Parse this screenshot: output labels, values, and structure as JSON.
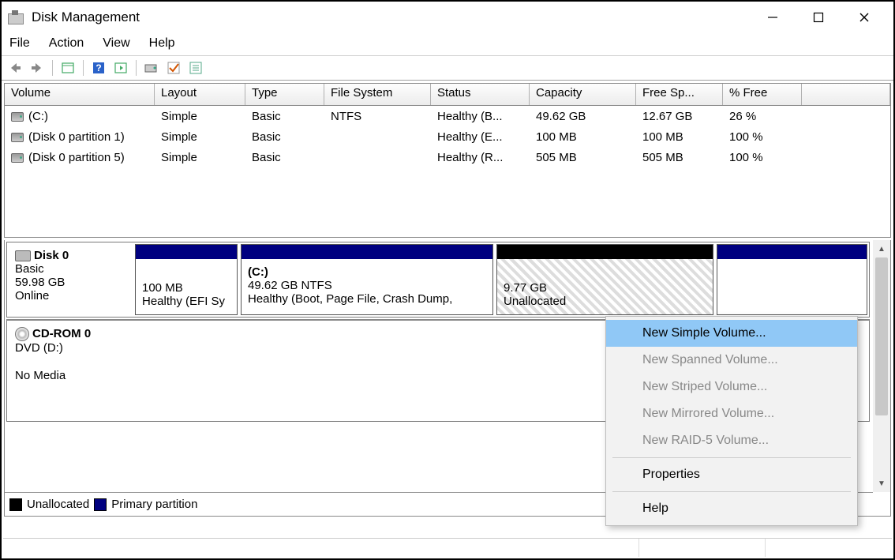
{
  "window": {
    "title": "Disk Management"
  },
  "menu": {
    "file": "File",
    "action": "Action",
    "view": "View",
    "help": "Help"
  },
  "table": {
    "headers": {
      "volume": "Volume",
      "layout": "Layout",
      "type": "Type",
      "fs": "File System",
      "status": "Status",
      "capacity": "Capacity",
      "free": "Free Sp...",
      "pct": "% Free"
    },
    "rows": [
      {
        "volume": "(C:)",
        "layout": "Simple",
        "type": "Basic",
        "fs": "NTFS",
        "status": "Healthy (B...",
        "capacity": "49.62 GB",
        "free": "12.67 GB",
        "pct": "26 %"
      },
      {
        "volume": "(Disk 0 partition 1)",
        "layout": "Simple",
        "type": "Basic",
        "fs": "",
        "status": "Healthy (E...",
        "capacity": "100 MB",
        "free": "100 MB",
        "pct": "100 %"
      },
      {
        "volume": "(Disk 0 partition 5)",
        "layout": "Simple",
        "type": "Basic",
        "fs": "",
        "status": "Healthy (R...",
        "capacity": "505 MB",
        "free": "505 MB",
        "pct": "100 %"
      }
    ]
  },
  "disk0": {
    "name": "Disk 0",
    "type": "Basic",
    "size": "59.98 GB",
    "state": "Online",
    "p1": {
      "size": "100 MB",
      "status": "Healthy (EFI Sy"
    },
    "p2": {
      "label": "(C:)",
      "size": "49.62 GB NTFS",
      "status": "Healthy (Boot, Page File, Crash Dump,"
    },
    "p3": {
      "size": "9.77 GB",
      "status": "Unallocated"
    }
  },
  "cdrom": {
    "name": "CD-ROM 0",
    "label": "DVD (D:)",
    "state": "No Media"
  },
  "legend": {
    "unalloc": "Unallocated",
    "primary": "Primary partition"
  },
  "context": {
    "new_simple": "New Simple Volume...",
    "new_spanned": "New Spanned Volume...",
    "new_striped": "New Striped Volume...",
    "new_mirrored": "New Mirrored Volume...",
    "new_raid5": "New RAID-5 Volume...",
    "properties": "Properties",
    "help": "Help"
  }
}
